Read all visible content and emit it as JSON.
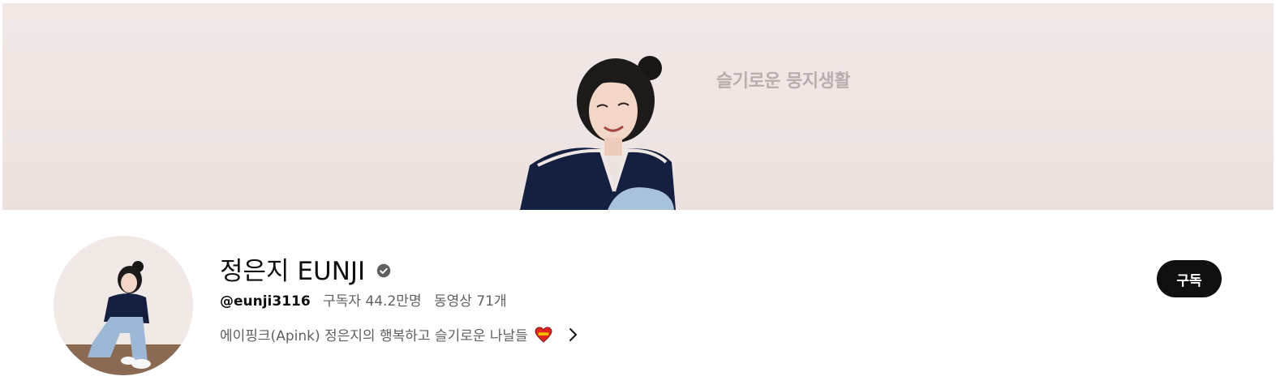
{
  "banner": {
    "text": "슬기로운 뭉지생활"
  },
  "channel": {
    "name": "정은지 EUNJI",
    "verified_icon": "verified-check-icon",
    "handle": "@eunji3116",
    "subscribers": "구독자 44.2만명",
    "videos": "동영상 71개",
    "description": "에이핑크(Apink) 정은지의 행복하고 슬기로운 나날들",
    "description_emoji": "heart-emoji-icon",
    "more_icon": "chevron-right-icon"
  },
  "actions": {
    "subscribe_label": "구독"
  },
  "colors": {
    "subscribe_bg": "#0f0f0f",
    "text_primary": "#0f0f0f",
    "text_secondary": "#606060",
    "banner_bg": "#efe6e4"
  }
}
